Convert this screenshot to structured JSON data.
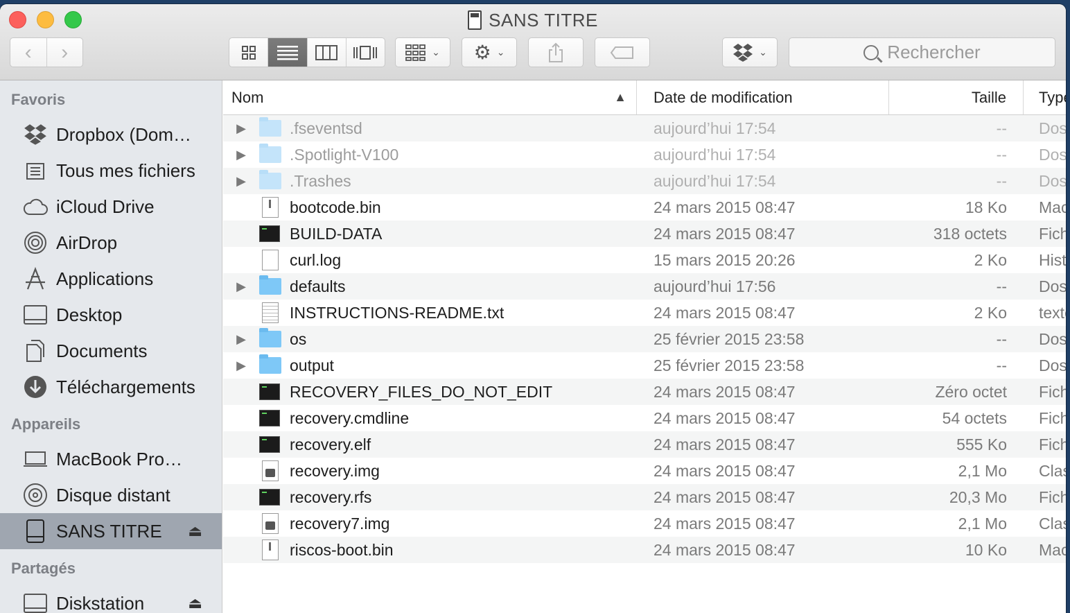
{
  "window": {
    "title": "SANS TITRE"
  },
  "toolbar": {
    "search_placeholder": "Rechercher"
  },
  "sidebar": {
    "sections": [
      {
        "label": "Favoris",
        "items": [
          {
            "label": "Dropbox (Dom…",
            "icon": "dropbox-icon"
          },
          {
            "label": "Tous mes fichiers",
            "icon": "all-files-icon"
          },
          {
            "label": "iCloud Drive",
            "icon": "cloud-icon"
          },
          {
            "label": "AirDrop",
            "icon": "airdrop-icon"
          },
          {
            "label": "Applications",
            "icon": "applications-icon"
          },
          {
            "label": "Desktop",
            "icon": "desktop-icon"
          },
          {
            "label": "Documents",
            "icon": "documents-icon"
          },
          {
            "label": "Téléchargements",
            "icon": "downloads-icon"
          }
        ]
      },
      {
        "label": "Appareils",
        "items": [
          {
            "label": "MacBook Pro…",
            "icon": "laptop-icon"
          },
          {
            "label": "Disque distant",
            "icon": "remote-disc-icon"
          },
          {
            "label": "SANS TITRE",
            "icon": "drive-icon",
            "selected": true,
            "eject": true
          }
        ]
      },
      {
        "label": "Partagés",
        "items": [
          {
            "label": "Diskstation",
            "icon": "server-icon",
            "eject": true
          }
        ]
      }
    ]
  },
  "columns": {
    "name": "Nom",
    "date": "Date de modification",
    "size": "Taille",
    "type": "Type"
  },
  "files": [
    {
      "name": ".fseventsd",
      "date": "aujourd’hui 17:54",
      "size": "--",
      "type": "Dossier",
      "kind": "folder",
      "hidden": true
    },
    {
      "name": ".Spotlight-V100",
      "date": "aujourd’hui 17:54",
      "size": "--",
      "type": "Dossier",
      "kind": "folder",
      "hidden": true
    },
    {
      "name": ".Trashes",
      "date": "aujourd’hui 17:54",
      "size": "--",
      "type": "Dossier",
      "kind": "folder",
      "hidden": true
    },
    {
      "name": "bootcode.bin",
      "date": "24 mars 2015 08:47",
      "size": "18 Ko",
      "type": "MacBinary",
      "kind": "exe"
    },
    {
      "name": "BUILD-DATA",
      "date": "24 mars 2015 08:47",
      "size": "318 octets",
      "type": "Fichier",
      "kind": "term"
    },
    {
      "name": "curl.log",
      "date": "15 mars 2015 20:26",
      "size": "2 Ko",
      "type": "Historique",
      "kind": "doc"
    },
    {
      "name": "defaults",
      "date": "aujourd’hui 17:56",
      "size": "--",
      "type": "Dossier",
      "kind": "folder"
    },
    {
      "name": "INSTRUCTIONS-README.txt",
      "date": "24 mars 2015 08:47",
      "size": "2 Ko",
      "type": "texte",
      "kind": "txt"
    },
    {
      "name": "os",
      "date": "25 février 2015 23:58",
      "size": "--",
      "type": "Dossier",
      "kind": "folder"
    },
    {
      "name": "output",
      "date": "25 février 2015 23:58",
      "size": "--",
      "type": "Dossier",
      "kind": "folder"
    },
    {
      "name": "RECOVERY_FILES_DO_NOT_EDIT",
      "date": "24 mars 2015 08:47",
      "size": "Zéro octet",
      "type": "Fichier",
      "kind": "term"
    },
    {
      "name": "recovery.cmdline",
      "date": "24 mars 2015 08:47",
      "size": "54 octets",
      "type": "Fichier",
      "kind": "term"
    },
    {
      "name": "recovery.elf",
      "date": "24 mars 2015 08:47",
      "size": "555 Ko",
      "type": "Fichier",
      "kind": "term"
    },
    {
      "name": "recovery.img",
      "date": "24 mars 2015 08:47",
      "size": "2,1 Mo",
      "type": "Classeur",
      "kind": "img"
    },
    {
      "name": "recovery.rfs",
      "date": "24 mars 2015 08:47",
      "size": "20,3 Mo",
      "type": "Fichier",
      "kind": "term"
    },
    {
      "name": "recovery7.img",
      "date": "24 mars 2015 08:47",
      "size": "2,1 Mo",
      "type": "Classeur",
      "kind": "img"
    },
    {
      "name": "riscos-boot.bin",
      "date": "24 mars 2015 08:47",
      "size": "10 Ko",
      "type": "MacBinary",
      "kind": "exe"
    }
  ]
}
